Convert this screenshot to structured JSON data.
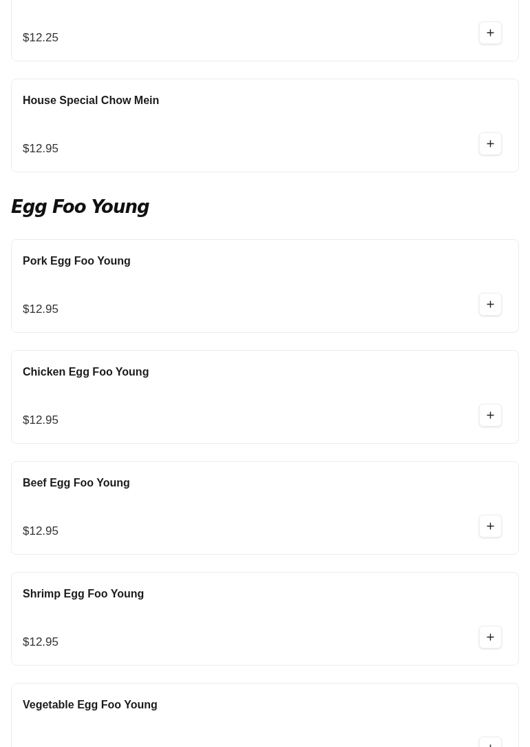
{
  "sections": [
    {
      "items": [
        {
          "price": "$12.25"
        },
        {
          "name": "House Special Chow Mein",
          "price": "$12.95"
        }
      ]
    },
    {
      "heading": "Egg Foo Young",
      "items": [
        {
          "name": "Pork Egg Foo Young",
          "price": "$12.95"
        },
        {
          "name": "Chicken Egg Foo Young",
          "price": "$12.95"
        },
        {
          "name": "Beef Egg Foo Young",
          "price": "$12.95"
        },
        {
          "name": "Shrimp Egg Foo Young",
          "price": "$12.95"
        },
        {
          "name": "Vegetable Egg Foo Young"
        }
      ]
    }
  ]
}
